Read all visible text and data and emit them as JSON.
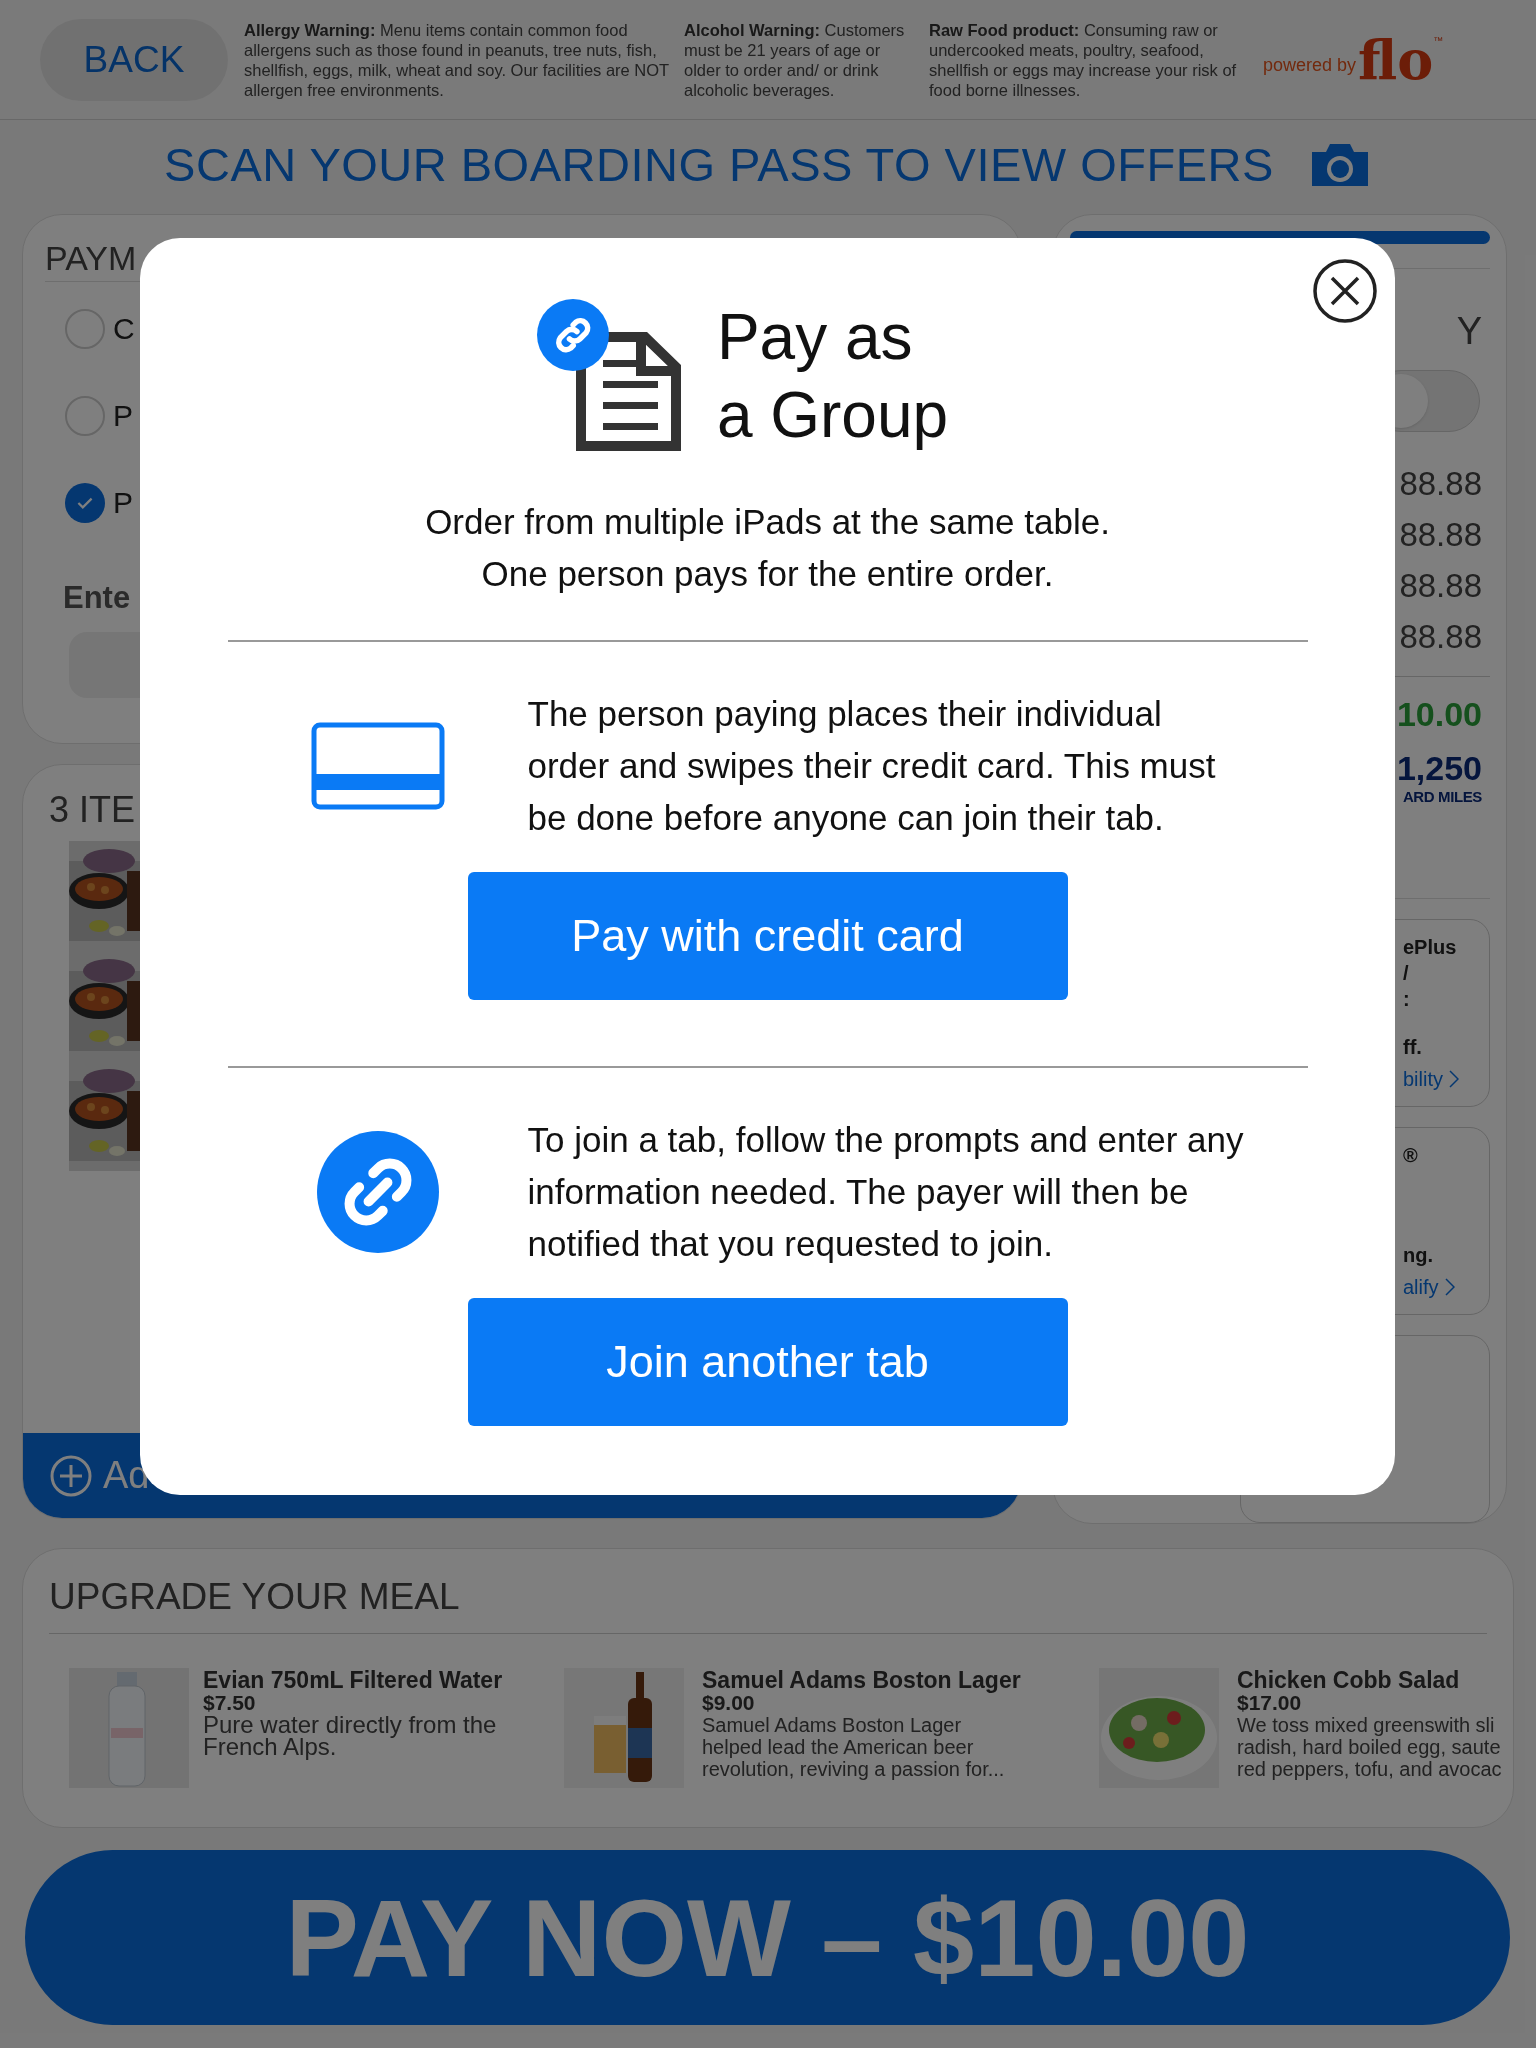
{
  "header": {
    "back_button": "BACK",
    "warnings": [
      {
        "title": "Allergy Warning:",
        "text": "Menu items contain common food allergens such as those found in peanuts, tree nuts, fish, shellfish, eggs, milk, wheat and soy.  Our facilities are NOT allergen free environments."
      },
      {
        "title": "Alcohol Warning:",
        "text": "Customers must be 21 years of age or older to order and/ or drink alcoholic beverages."
      },
      {
        "title": "Raw Food product:",
        "text": "Consuming raw or undercooked meats, poultry, seafood, shellfish or eggs may increase your risk of food borne illnesses."
      }
    ],
    "powered_by": "powered by",
    "logo": "flo",
    "trademark": "™"
  },
  "banner": "SCAN YOUR BOARDING PASS TO VIEW OFFERS",
  "payment_card": {
    "title": "PAYM",
    "options": [
      {
        "label": "C",
        "selected": false
      },
      {
        "label": "P",
        "selected": false
      },
      {
        "label": "P",
        "selected": true
      }
    ],
    "field_label": "Ente"
  },
  "items_card": {
    "title": "3 ITE",
    "add_button": "Ad"
  },
  "summary_card": {
    "heading": "Y",
    "toggle": {
      "on": false
    },
    "prices": [
      "88.88",
      "88.88",
      "88.88",
      "88.88"
    ],
    "total": "10.00",
    "miles": "1,250",
    "miles_label": "ARD MILES",
    "offers": [
      {
        "kind": "text",
        "lines": [
          "ePlus",
          "/",
          ":",
          "ff."
        ],
        "link": "bility"
      },
      {
        "kind": "text",
        "lines": [
          "®",
          "ng."
        ],
        "link": "alify"
      },
      {
        "kind": "empty"
      }
    ]
  },
  "modal": {
    "title_lines": [
      "Pay as",
      "a Group"
    ],
    "description_lines": [
      "Order from multiple iPads at the same table.",
      "One person pays for the entire order."
    ],
    "sections": [
      {
        "kind": "card",
        "text": "The person paying places their individual order and swipes their credit card. This must be done before anyone can join their tab.",
        "button": "Pay with credit card"
      },
      {
        "kind": "link",
        "text": "To join a tab, follow the prompts and enter any information needed. The payer will then be notified that you requested to join.",
        "button": "Join another tab"
      }
    ]
  },
  "upgrade": {
    "title": "UPGRADE YOUR MEAL",
    "items": [
      {
        "name": "Evian 750mL Filtered Water",
        "price": "$7.50",
        "description_lines": [
          "Pure water directly from the",
          "French Alps."
        ],
        "large": true
      },
      {
        "name": "Samuel Adams Boston Lager",
        "price": "$9.00",
        "description_lines": [
          "Samuel Adams Boston Lager",
          "helped lead the American beer",
          "revolution, reviving a passion for..."
        ],
        "large": false
      },
      {
        "name": "Chicken Cobb Salad",
        "price": "$17.00",
        "description_lines": [
          "We toss mixed greenswith sli",
          "radish, hard boiled egg, saute",
          "red peppers, tofu, and avocac"
        ],
        "large": false
      }
    ]
  },
  "pay_button": "PAY NOW – $10.00"
}
